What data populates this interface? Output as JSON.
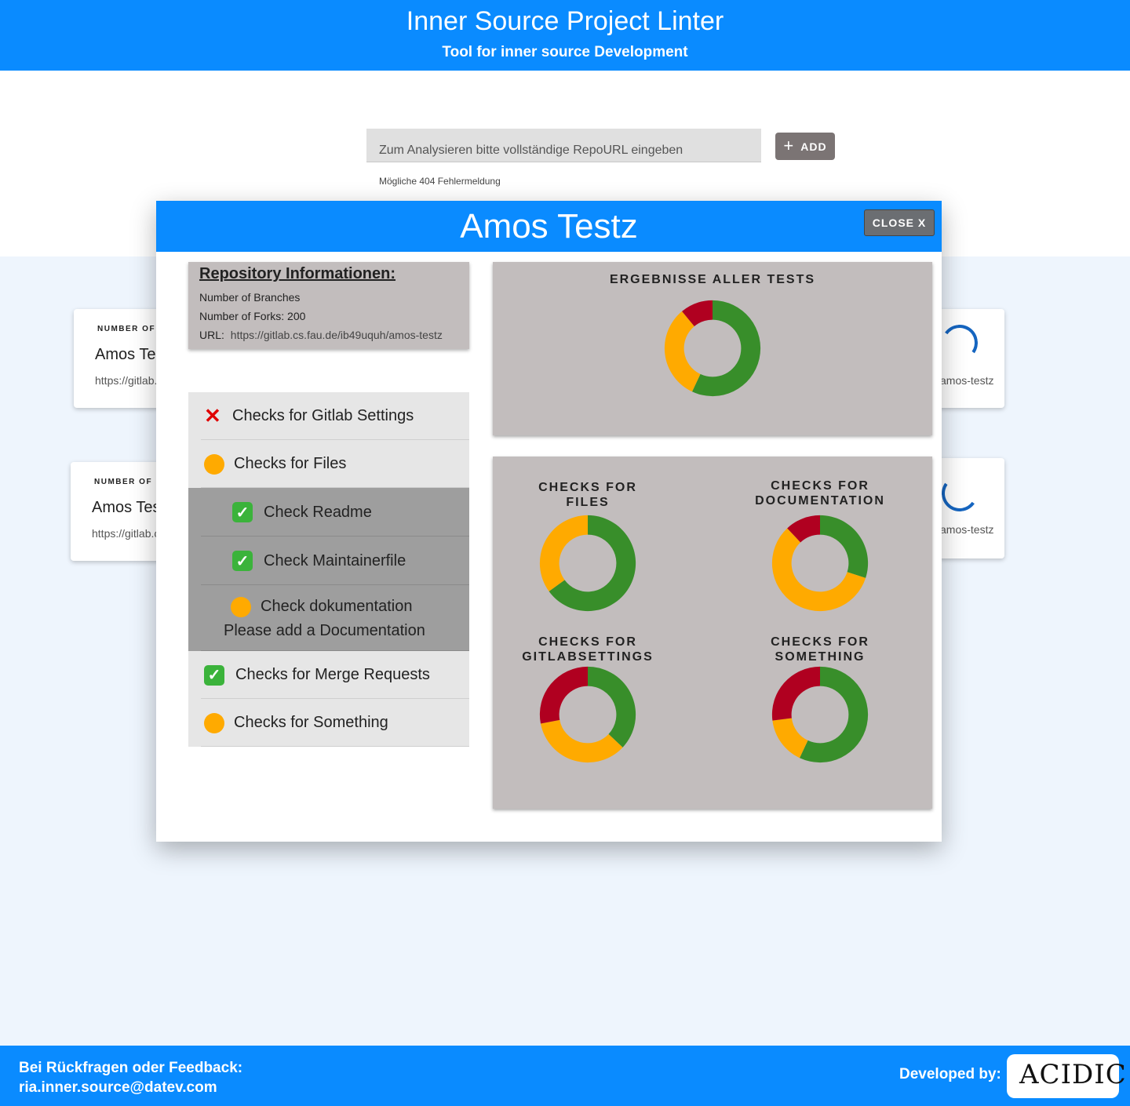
{
  "header": {
    "title": "Inner Source Project Linter",
    "subtitle": "Tool for inner source Development"
  },
  "search": {
    "placeholder": "Zum Analysieren bitte vollständige RepoURL eingeben",
    "add_label": "ADD",
    "add_icon": "plus-icon",
    "helper": "Mögliche 404 Fehlermeldung"
  },
  "cards": [
    {
      "overline": "NUMBER OF F",
      "title": "Amos Testz",
      "url": "https://gitlab.cs.fau.de/ib49uquh/amos-testz"
    },
    {
      "overline": "NUMBER OF F",
      "title": "Amos Testz",
      "url": "https://gitlab.cs.fau.de/ib49uquh/amos-testz"
    }
  ],
  "right_cards": [
    {
      "url_tail": "amos-testz",
      "icon": "loading-spinner-icon"
    },
    {
      "url_tail": "amos-testz",
      "icon": "loading-spinner-icon"
    }
  ],
  "modal": {
    "title": "Amos Testz",
    "close_label": "CLOSE X",
    "info": {
      "heading": "Repository Informationen:",
      "branches": "Number of Branches",
      "forks": "Number of Forks: 200",
      "url_label": "URL:",
      "url": "https://gitlab.cs.fau.de/ib49uquh/amos-testz"
    },
    "checks": [
      {
        "label": "Checks for Gitlab Settings",
        "status": "failed"
      },
      {
        "label": "Checks for Files",
        "status": "warning"
      },
      {
        "label": "Check Readme",
        "status": "passed"
      },
      {
        "label": "Check Maintainerfile",
        "status": "passed"
      },
      {
        "label": "Check dokumentation",
        "status": "warning",
        "message": "Please add a Documentation"
      },
      {
        "label": "Checks for Merge Requests",
        "status": "passed"
      },
      {
        "label": "Checks for Something",
        "status": "warning"
      }
    ]
  },
  "colors": {
    "primary": "#0a8bff",
    "panel": "#c2bdbd",
    "passed": "#388e2a",
    "warning": "#ffaa00",
    "failed": "#b00020"
  },
  "chart_data": [
    {
      "type": "pie",
      "title": "ERGEBNISSE ALLER TESTS",
      "categories": [
        "passed",
        "warning",
        "failed"
      ],
      "values": [
        57,
        32,
        11
      ]
    },
    {
      "type": "pie",
      "title": "CHECKS FOR FILES",
      "categories": [
        "passed",
        "warning",
        "failed"
      ],
      "values": [
        65,
        35,
        0
      ]
    },
    {
      "type": "pie",
      "title": "CHECKS FOR DOCUMENTATION",
      "categories": [
        "passed",
        "warning",
        "failed"
      ],
      "values": [
        30,
        58,
        12
      ]
    },
    {
      "type": "pie",
      "title": "CHECKS FOR GITLABSETTINGS",
      "categories": [
        "passed",
        "warning",
        "failed"
      ],
      "values": [
        37,
        35,
        28
      ]
    },
    {
      "type": "pie",
      "title": "CHECKS FOR SOMETHING",
      "categories": [
        "passed",
        "warning",
        "failed"
      ],
      "values": [
        57,
        16,
        27
      ]
    }
  ],
  "footer": {
    "feedback_line1": "Bei Rückfragen oder Feedback:",
    "feedback_line2": "ria.inner.source@datev.com",
    "developed_by": "Developed by:",
    "logo_text": "ACIDIC"
  }
}
